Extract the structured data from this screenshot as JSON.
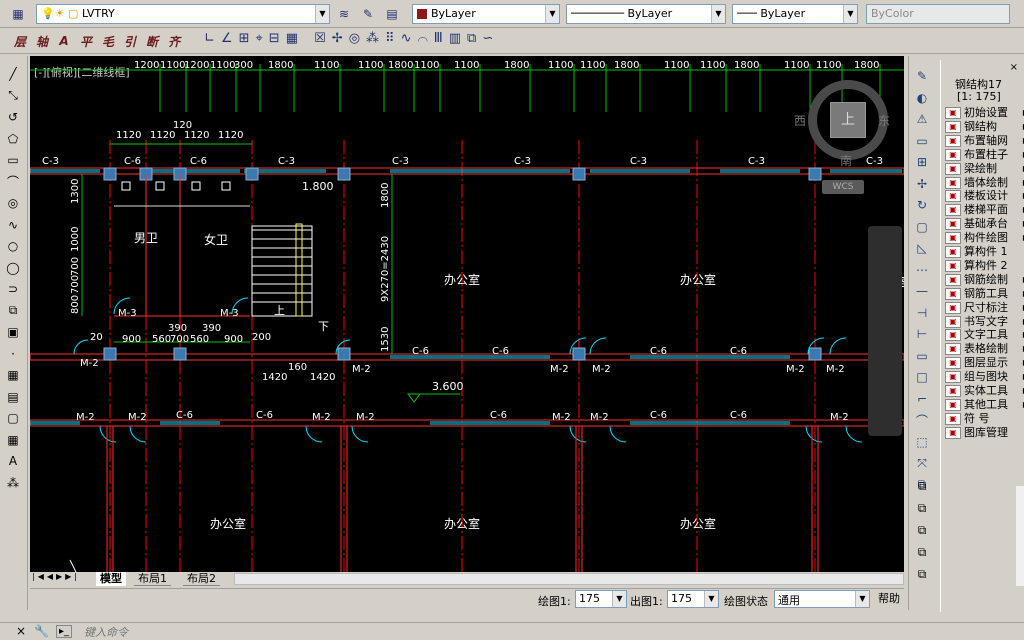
{
  "toolbar1": {
    "layer_name": "LVTRY",
    "color": "ByLayer",
    "linetype": "ByLayer",
    "lineweight": "ByLayer",
    "plotstyle": "ByColor"
  },
  "toolbar2": {
    "chars": [
      "层",
      "轴",
      "A",
      "平",
      "毛",
      "引",
      "断",
      "齐"
    ]
  },
  "canvas": {
    "viewport_label": "[-][俯视][二维线框]",
    "top_dims": [
      "1200",
      "1100",
      "1200",
      "1100",
      "300",
      "1800",
      "1100",
      "1100",
      "1800",
      "1100",
      "1100",
      "1800",
      "1100",
      "1100",
      "1800",
      "1100",
      "1100",
      "1800",
      "1100",
      "1100",
      "1800"
    ],
    "dim2": [
      "1120",
      "1120",
      "1120",
      "1120"
    ],
    "dim_120": "120",
    "window_labels_top": [
      "C-3",
      "C-6",
      "C-6",
      "C-3",
      "C-3",
      "C-3",
      "C-3",
      "C-3",
      "C-3"
    ],
    "rooms": {
      "male_wc": "男卫",
      "female_wc": "女卫",
      "office": "办公室",
      "up": "上",
      "down": "下"
    },
    "stair_dims": [
      "1.800",
      "1800",
      "9X270=2430",
      "1530"
    ],
    "left_dims": [
      "1300",
      "1000",
      "700",
      "700",
      "800"
    ],
    "bottom_dims": [
      "900",
      "560",
      "700",
      "560",
      "900"
    ],
    "door_labels": [
      "M-3",
      "M-3",
      "M-2",
      "M-2",
      "M-2",
      "M-2",
      "M-2",
      "M-2"
    ],
    "mid_dims": [
      "390",
      "390",
      "200",
      "20",
      "160",
      "1420",
      "1420"
    ],
    "mid_windows": [
      "C-6",
      "C-6",
      "C-6",
      "C-6"
    ],
    "level": "3.600",
    "row2_windows": [
      "C-6",
      "C-6",
      "C-6",
      "C-6",
      "C-6"
    ],
    "compass": {
      "north": "南",
      "west": "西",
      "east": "东",
      "top": "上",
      "wcs": "WCS"
    }
  },
  "tabs": [
    "模型",
    "布局1",
    "布局2"
  ],
  "status": {
    "draw_scale_label": "绘图1:",
    "draw_scale": "175",
    "out_scale_label": "出图1:",
    "out_scale": "175",
    "state_label": "绘图状态",
    "state_value": "通用",
    "help": "帮助"
  },
  "command": {
    "placeholder": "键入命令"
  },
  "panel": {
    "title": "钢结构17",
    "scale": "[1: 175]",
    "items": [
      "初始设置",
      "钢结构",
      "布置轴网",
      "布置柱子",
      "梁绘制",
      "墙体绘制",
      "楼板设计",
      "楼梯平面",
      "基础承台",
      "构件绘图",
      "算构件 1",
      "算构件 2",
      "钢筋绘制",
      "钢筋工具",
      "尺寸标注",
      "书写文字",
      "文字工具",
      "表格绘制",
      "图层显示",
      "组与图块",
      "实体工具",
      "其他工具",
      "符 号",
      "图库管理"
    ]
  },
  "colors": {
    "canvas": "#000000",
    "wall": "#ff3030",
    "axis": "#ff0000",
    "dim": "#00c000",
    "text": "#ffffff",
    "cyan": "#00e0ff"
  }
}
